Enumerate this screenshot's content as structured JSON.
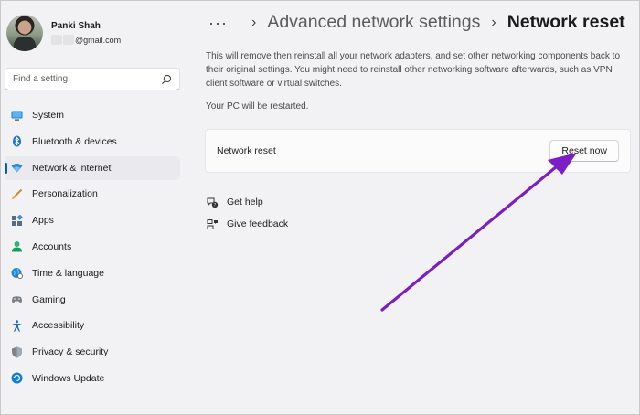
{
  "profile": {
    "name": "Panki Shah",
    "email": "@gmail.com"
  },
  "search": {
    "placeholder": "Find a setting"
  },
  "sidebar": {
    "items": [
      {
        "label": "System",
        "icon": "monitor-icon"
      },
      {
        "label": "Bluetooth & devices",
        "icon": "bluetooth-icon"
      },
      {
        "label": "Network & internet",
        "icon": "wifi-icon",
        "active": true
      },
      {
        "label": "Personalization",
        "icon": "brush-icon"
      },
      {
        "label": "Apps",
        "icon": "apps-icon"
      },
      {
        "label": "Accounts",
        "icon": "person-icon"
      },
      {
        "label": "Time & language",
        "icon": "globe-clock-icon"
      },
      {
        "label": "Gaming",
        "icon": "controller-icon"
      },
      {
        "label": "Accessibility",
        "icon": "accessibility-icon"
      },
      {
        "label": "Privacy & security",
        "icon": "shield-icon"
      },
      {
        "label": "Windows Update",
        "icon": "update-icon"
      }
    ]
  },
  "breadcrumb": {
    "more": "···",
    "parent": "Advanced network settings",
    "current": "Network reset"
  },
  "main": {
    "description": "This will remove then reinstall all your network adapters, and set other networking components back to their original settings. You might need to reinstall other networking software afterwards, such as VPN client software or virtual switches.",
    "restart_note": "Your PC will be restarted.",
    "card_label": "Network reset",
    "reset_button": "Reset now",
    "get_help": "Get help",
    "give_feedback": "Give feedback"
  },
  "colors": {
    "accent": "#005fb8",
    "annotation_arrow": "#7b1fc4"
  }
}
